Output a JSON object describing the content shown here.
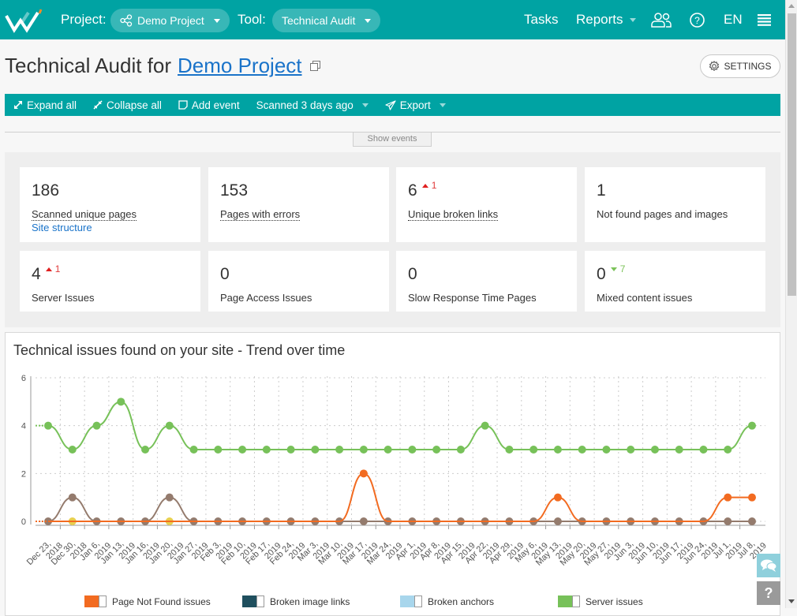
{
  "topbar": {
    "project_label": "Project:",
    "project_value": "Demo Project",
    "tool_label": "Tool:",
    "tool_value": "Technical Audit",
    "nav": {
      "tasks": "Tasks",
      "reports": "Reports",
      "language": "EN"
    },
    "icons": [
      "logo-w",
      "share-nodes-icon",
      "users-icon",
      "help-circle-icon",
      "hamburger-menu-icon"
    ]
  },
  "page": {
    "title_prefix": "Technical Audit for",
    "title_link": "Demo Project",
    "settings_label": "SETTINGS"
  },
  "toolbar": {
    "expand_all": "Expand all",
    "collapse_all": "Collapse all",
    "add_event": "Add event",
    "scanned": "Scanned 3 days ago",
    "export": "Export"
  },
  "show_events_label": "Show events",
  "cards": [
    {
      "value": "186",
      "label": "Scanned unique pages",
      "link": "Site structure",
      "dotted": true
    },
    {
      "value": "153",
      "label": "Pages with errors",
      "dotted": true
    },
    {
      "value": "6",
      "label": "Unique broken links",
      "delta": "1",
      "delta_dir": "up",
      "dotted": true
    },
    {
      "value": "1",
      "label": "Not found pages and images"
    },
    {
      "value": "4",
      "label": "Server Issues",
      "delta": "1",
      "delta_dir": "up"
    },
    {
      "value": "0",
      "label": "Page Access Issues"
    },
    {
      "value": "0",
      "label": "Slow Response Time Pages"
    },
    {
      "value": "0",
      "label": "Mixed content issues",
      "delta": "7",
      "delta_dir": "down"
    }
  ],
  "chart_data": {
    "type": "line",
    "title": "Technical issues found on your site - Trend over time",
    "xlabel": "",
    "ylabel": "",
    "ylim": [
      0,
      6
    ],
    "yticks": [
      "0",
      "2",
      "4",
      "6"
    ],
    "grid": true,
    "legend_position": "bottom",
    "categories": [
      "Dec 23, 2018",
      "Dec 30, 2018",
      "Jan 6, 2019",
      "Jan 13, 2019",
      "Jan 16, 2019",
      "Jan 20, 2019",
      "Jan 27, 2019",
      "Feb 3, 2019",
      "Feb 10, 2019",
      "Feb 17, 2019",
      "Feb 24, 2019",
      "Mar 3, 2019",
      "Mar 10, 2019",
      "Mar 17, 2019",
      "Mar 24, 2019",
      "Apr 1, 2019",
      "Apr 8, 2019",
      "Apr 15, 2019",
      "Apr 22, 2019",
      "Apr 29, 2019",
      "May 6, 2019",
      "May 13, 2019",
      "May 20, 2019",
      "May 27, 2019",
      "Jun 3, 2019",
      "Jun 10, 2019",
      "Jun 17, 2019",
      "Jun 24, 2019",
      "Jul 1, 2019",
      "Jul 8, 2019"
    ],
    "series": [
      {
        "name": "Server issues",
        "color": "#77c159",
        "legend": true,
        "values": [
          4,
          3,
          4,
          5,
          3,
          4,
          3,
          3,
          3,
          3,
          3,
          3,
          3,
          3,
          3,
          3,
          3,
          3,
          4,
          3,
          3,
          3,
          3,
          3,
          3,
          3,
          3,
          3,
          3,
          4
        ]
      },
      {
        "name": "Page Not Found issues",
        "color": "#f26b21",
        "legend": true,
        "values": [
          0,
          0,
          0,
          0,
          0,
          0,
          0,
          0,
          0,
          0,
          0,
          0,
          0,
          2,
          0,
          0,
          0,
          0,
          0,
          0,
          0,
          1,
          0,
          0,
          0,
          0,
          0,
          0,
          1,
          1
        ]
      },
      {
        "name": "Yellow series",
        "color": "#e9cf4e",
        "legend": false,
        "values": [
          0,
          0,
          0,
          0,
          0,
          0,
          0,
          0,
          0,
          0,
          0,
          0,
          0,
          0,
          0,
          0,
          0,
          0,
          0,
          0,
          0,
          0,
          0,
          0,
          0,
          0,
          0,
          0,
          0,
          0
        ],
        "visible_points": [
          1,
          5
        ]
      },
      {
        "name": "Brown series",
        "color": "#947b6d",
        "legend": false,
        "values": [
          0,
          1,
          0,
          0,
          0,
          1,
          0,
          0,
          0,
          0,
          0,
          0,
          0,
          0,
          0,
          0,
          0,
          0,
          0,
          0,
          0,
          0,
          0,
          0,
          0,
          0,
          0,
          0,
          0,
          0
        ]
      }
    ],
    "legend": [
      {
        "name": "Page Not Found issues",
        "color": "#f26b21"
      },
      {
        "name": "Broken image links",
        "color": "#1f4f5e"
      },
      {
        "name": "Broken anchors",
        "color": "#a8d6ec"
      },
      {
        "name": "Server issues",
        "color": "#77c159"
      }
    ]
  },
  "floating": {
    "help_label": "?"
  },
  "colors": {
    "brand": "#00a3a3",
    "link": "#1a73c9"
  }
}
